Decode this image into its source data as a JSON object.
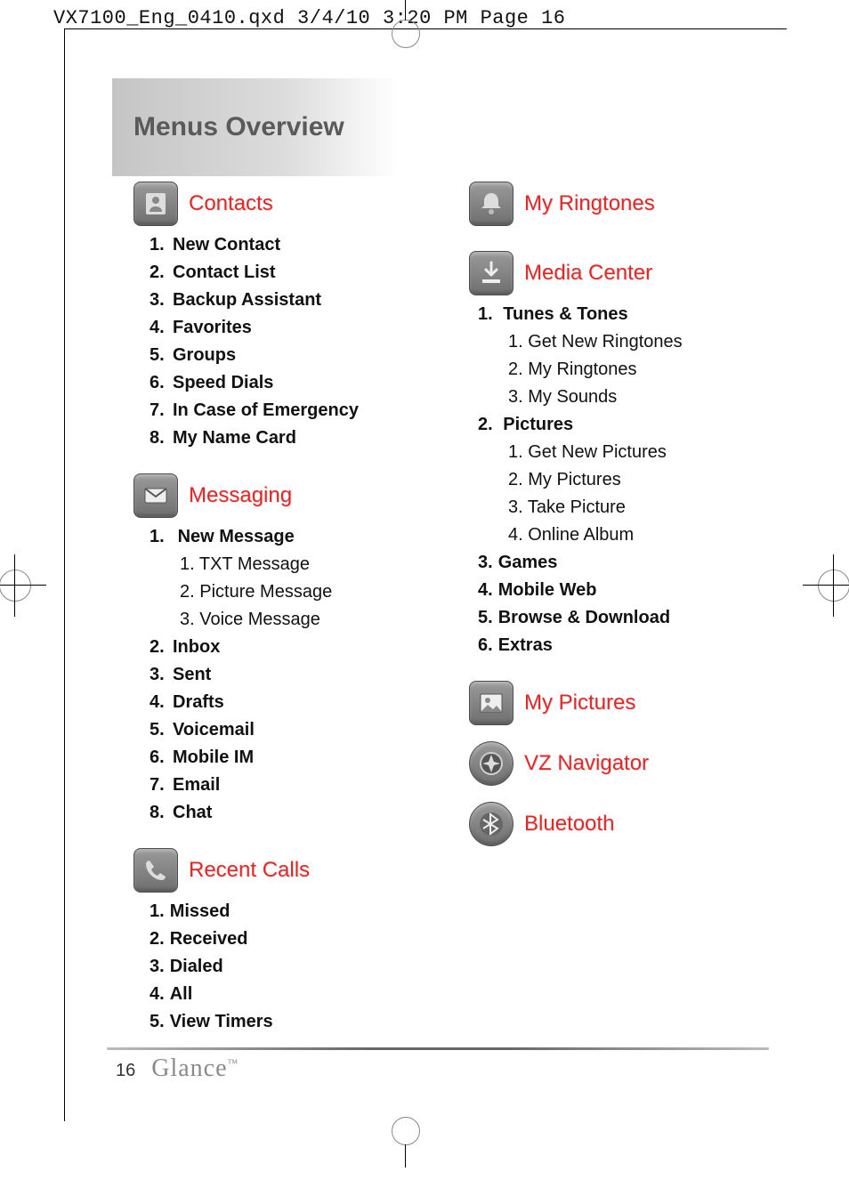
{
  "header": {
    "print_info": "VX7100_Eng_0410.qxd  3/4/10  3:20 PM  Page 16"
  },
  "title": "Menus Overview",
  "footer": {
    "page_number": "16",
    "brand": "Glance",
    "tm": "™"
  },
  "left": {
    "contacts": {
      "title": "Contacts",
      "items": [
        "New Contact",
        "Contact List",
        "Backup Assistant",
        "Favorites",
        "Groups",
        "Speed Dials",
        "In Case of Emergency",
        "My Name Card"
      ]
    },
    "messaging": {
      "title": "Messaging",
      "items": [
        {
          "label": "New Message",
          "sub": [
            "TXT Message",
            "Picture Message",
            "Voice Message"
          ]
        },
        {
          "label": "Inbox"
        },
        {
          "label": "Sent"
        },
        {
          "label": "Drafts"
        },
        {
          "label": "Voicemail"
        },
        {
          "label": "Mobile IM"
        },
        {
          "label": "Email"
        },
        {
          "label": "Chat"
        }
      ]
    },
    "recent_calls": {
      "title": "Recent Calls",
      "items": [
        "Missed",
        "Received",
        "Dialed",
        "All",
        "View Timers"
      ]
    }
  },
  "right": {
    "my_ringtones": {
      "title": "My Ringtones"
    },
    "media_center": {
      "title": "Media Center",
      "items": [
        {
          "label": "Tunes & Tones",
          "sub": [
            "Get New Ringtones",
            "My Ringtones",
            "My Sounds"
          ]
        },
        {
          "label": "Pictures",
          "sub": [
            "Get New Pictures",
            "My Pictures",
            "Take Picture",
            "Online Album"
          ]
        },
        {
          "label": "Games"
        },
        {
          "label": "Mobile Web"
        },
        {
          "label": "Browse & Download"
        },
        {
          "label": "Extras"
        }
      ]
    },
    "my_pictures": {
      "title": "My Pictures"
    },
    "vz_navigator": {
      "title": "VZ Navigator"
    },
    "bluetooth": {
      "title": "Bluetooth"
    }
  }
}
